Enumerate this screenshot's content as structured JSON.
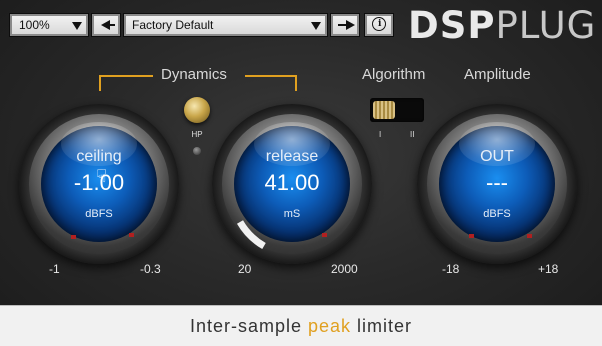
{
  "toolbar": {
    "zoom_value": "100%",
    "preset_value": "Factory Default"
  },
  "logo": {
    "part1": "DSP",
    "part2": "PLUG"
  },
  "sections": {
    "dynamics": "Dynamics",
    "algorithm": "Algorithm",
    "amplitude": "Amplitude"
  },
  "hp": {
    "label": "HP"
  },
  "switch": {
    "label_left": "I",
    "label_right": "II"
  },
  "knobs": {
    "ceiling": {
      "title": "ceiling",
      "value": "-1.00",
      "unit": "dBFS",
      "min": "-1",
      "max": "-0.3"
    },
    "release": {
      "title": "release",
      "value": "41.00",
      "unit": "mS",
      "min": "20",
      "max": "2000"
    },
    "out": {
      "title": "OUT",
      "value": "---",
      "unit": "dBFS",
      "min": "-18",
      "max": "+18"
    }
  },
  "footer": {
    "pre": "Inter-sample ",
    "highlight": "peak",
    "post": " limiter"
  },
  "colors": {
    "accent": "#e0a020",
    "knob_blue": "#1a8ef0",
    "background": "#2a2a2a",
    "footer_bg": "#f1f1f1"
  },
  "icons": [
    "chevron-down-icon",
    "prev-arrow-icon",
    "next-arrow-icon",
    "info-icon",
    "hand-cursor-icon"
  ]
}
